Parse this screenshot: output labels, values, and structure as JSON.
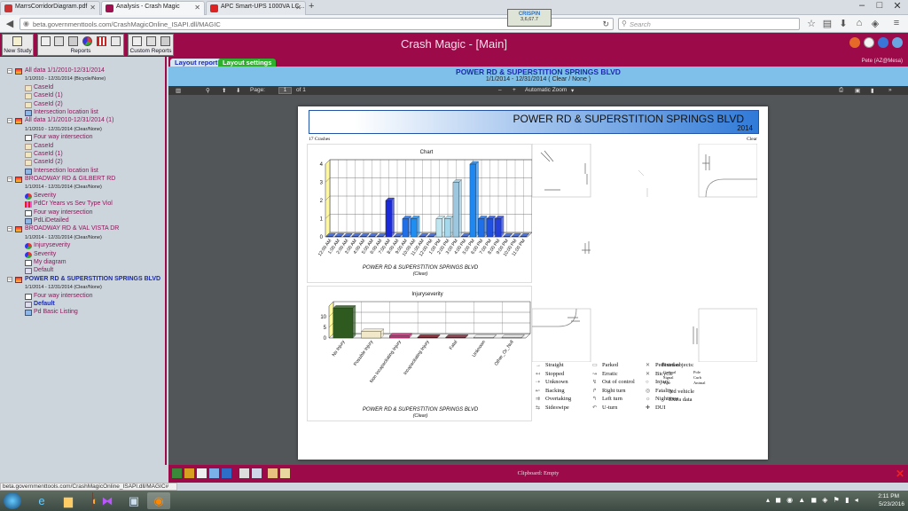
{
  "browser": {
    "tabs": [
      {
        "label": "MarrsCorridorDiagram.pdf",
        "active": false
      },
      {
        "label": "Analysis - Crash Magic",
        "active": true
      },
      {
        "label": "APC Smart-UPS 1000VA LC...",
        "active": false
      }
    ],
    "url": "beta.governmenttools.com/CrashMagicOnline_ISAPI.dll/MAGIC",
    "search_placeholder": "Search",
    "crispin_title": "CRISPIN",
    "crispin_value": "3,6,67.7"
  },
  "app": {
    "title": "Crash Magic - [Main]",
    "new_study_label": "New Study",
    "reports_label": "Reports",
    "custom_reports_label": "Custom Reports",
    "user_label": "Pete (AZ@Mesa)"
  },
  "tree": [
    {
      "kind": "top",
      "text": "All data 1/1/2010-12/31/2014"
    },
    {
      "kind": "sub",
      "text": "1/1/2010 - 12/31/2014 (Bicycle/None)"
    },
    {
      "kind": "leaf",
      "text": "CaseId",
      "icon": "person"
    },
    {
      "kind": "leaf",
      "text": "CaseId (1)",
      "icon": "person"
    },
    {
      "kind": "leaf",
      "text": "CaseId (2)",
      "icon": "person"
    },
    {
      "kind": "leaf",
      "text": "Intersection location list",
      "icon": "list"
    },
    {
      "kind": "top",
      "text": "All data 1/1/2010-12/31/2014 (1)"
    },
    {
      "kind": "sub",
      "text": "1/1/2010 - 12/31/2014 (Clear/None)"
    },
    {
      "kind": "leaf",
      "text": "Four way intersection",
      "icon": "diagram"
    },
    {
      "kind": "leaf",
      "text": "CaseId",
      "icon": "person"
    },
    {
      "kind": "leaf",
      "text": "CaseId (1)",
      "icon": "person"
    },
    {
      "kind": "leaf",
      "text": "CaseId (2)",
      "icon": "person"
    },
    {
      "kind": "leaf",
      "text": "Intersection location list",
      "icon": "list"
    },
    {
      "kind": "top",
      "text": "BROADWAY RD & GILBERT RD"
    },
    {
      "kind": "sub",
      "text": "1/1/2014 - 12/31/2014 (Clear/None)"
    },
    {
      "kind": "leaf",
      "text": "Severity",
      "icon": "pie"
    },
    {
      "kind": "leaf",
      "text": "PdCr Years vs Sev Type Viol",
      "icon": "grid"
    },
    {
      "kind": "leaf",
      "text": "Four way intersection",
      "icon": "diagram"
    },
    {
      "kind": "leaf",
      "text": "PdLiDetailed",
      "icon": "list"
    },
    {
      "kind": "top",
      "text": "BROADWAY RD & VAL VISTA DR"
    },
    {
      "kind": "sub",
      "text": "1/1/2014 - 12/31/2014 (Clear/None)"
    },
    {
      "kind": "leaf",
      "text": "Injuryseverity",
      "icon": "pie"
    },
    {
      "kind": "leaf",
      "text": "Severity",
      "icon": "pie"
    },
    {
      "kind": "leaf",
      "text": "My diagram",
      "icon": "diagram"
    },
    {
      "kind": "leaf",
      "text": "Default",
      "icon": "doc"
    },
    {
      "kind": "top-selected",
      "text": "POWER RD & SUPERSTITION SPRINGS BLVD"
    },
    {
      "kind": "sub",
      "text": "1/1/2014 - 12/31/2014 (Clear/None)"
    },
    {
      "kind": "leaf",
      "text": "Four way intersection",
      "icon": "diagram"
    },
    {
      "kind": "leaf-selected",
      "text": "Default",
      "icon": "doc"
    },
    {
      "kind": "leaf",
      "text": "Pd Basic Listing",
      "icon": "list"
    }
  ],
  "report": {
    "tabs": [
      {
        "label": "Layout report",
        "active": true
      },
      {
        "label": "Layout settings",
        "active": false
      }
    ],
    "title": "POWER RD & SUPERSTITION SPRINGS BLVD",
    "subtitle": "1/1/2014 - 12/31/2014 ( Clear / None )",
    "pdf_page_label": "Page:",
    "pdf_page_value": "1",
    "pdf_of": "of 1",
    "pdf_zoom": "Automatic Zoom",
    "page_title": "POWER RD & SUPERSTITION SPRINGS BLVD",
    "page_year": "2014",
    "crash_count": "17 Crashes",
    "weather": "Clear",
    "chart1_footer": "POWER RD & SUPERSTITION SPRINGS BLVD",
    "chart1_footer2": "(Clear)",
    "chart2_footer": "POWER RD & SUPERSTITION SPRINGS BLVD",
    "chart2_footer2": "(Clear)",
    "legend": [
      {
        "sym": "→",
        "text": "Straight"
      },
      {
        "sym": "↤",
        "text": "Stopped"
      },
      {
        "sym": "⇢",
        "text": "Unknown"
      },
      {
        "sym": "↜",
        "text": "Backing"
      },
      {
        "sym": "⇉",
        "text": "Overtaking"
      },
      {
        "sym": "⇆",
        "text": "Sideswipe"
      },
      {
        "sym": "▭",
        "text": "Parked"
      },
      {
        "sym": "↝",
        "text": "Erratic"
      },
      {
        "sym": "↯",
        "text": "Out of control"
      },
      {
        "sym": "↱",
        "text": "Right turn"
      },
      {
        "sym": "↰",
        "text": "Left turn"
      },
      {
        "sym": "↶",
        "text": "U-turn"
      },
      {
        "sym": "✕",
        "text": "Pedestrian"
      },
      {
        "sym": "✕",
        "text": "Bicycle"
      },
      {
        "sym": "○",
        "text": "Injury"
      },
      {
        "sym": "◎",
        "text": "Fatality"
      },
      {
        "sym": "☼",
        "text": "Nighttime"
      },
      {
        "sym": "✚",
        "text": "DUI"
      }
    ],
    "fixed_objects_title": "Fixed objects:",
    "fixed_objects": [
      "General",
      "Pole",
      "Signal",
      "Curb",
      "Tree",
      "Animal"
    ],
    "extra_legend": [
      "3rd vehicle",
      "Extra data"
    ],
    "clipboard": "Clipboard: Empty"
  },
  "status_url": "beta.governmenttools.com/CrashMagicOnline_ISAPI.dll/MAGIC#",
  "clock": {
    "time": "2:11 PM",
    "date": "5/23/2016"
  },
  "colors": {
    "brand": "#9c0a4a",
    "panel": "#ccd4dc",
    "title_bar": "#7fc0ea",
    "link": "#8a1b5a",
    "selected": "#1a2bb5"
  },
  "chart_data": [
    {
      "type": "bar",
      "title": "Chart",
      "categories": [
        "12:00 AM",
        "1:00 AM",
        "2:00 AM",
        "3:00 AM",
        "4:00 AM",
        "5:00 AM",
        "6:00 AM",
        "7:00 AM",
        "8:00 AM",
        "9:00 AM",
        "10:00 AM",
        "11:00 AM",
        "12:00 PM",
        "1:00 PM",
        "2:00 PM",
        "3:00 PM",
        "4:00 PM",
        "5:00 PM",
        "6:00 PM",
        "7:00 PM",
        "8:00 PM",
        "9:00 PM",
        "10:00 PM",
        "11:00 PM"
      ],
      "values": [
        0,
        0,
        0,
        0,
        0,
        0,
        0,
        2,
        0,
        1,
        1,
        0,
        0,
        1,
        1,
        3,
        0,
        4,
        1,
        1,
        1,
        0,
        0,
        0
      ],
      "ylim": [
        0,
        4
      ],
      "yticks": [
        0,
        1,
        2,
        3,
        4
      ],
      "grid": true,
      "colors": [
        "#2f5fe0",
        "#2f5fe0",
        "#2f5fe0",
        "#2f5fe0",
        "#2f5fe0",
        "#2f5fe0",
        "#2f5fe0",
        "#1a2ad6",
        "#2f5fe0",
        "#1f6fe8",
        "#1f8ef0",
        "#2f5fe0",
        "#2f5fe0",
        "#bfe6f0",
        "#a6d8ec",
        "#9cc7de",
        "#2f5fe0",
        "#1e88f0",
        "#1e6fe8",
        "#2050e0",
        "#2440d8",
        "#2f5fe0",
        "#2f5fe0",
        "#2f5fe0"
      ]
    },
    {
      "type": "bar",
      "title": "Injuryseverity",
      "categories": [
        "No Injury",
        "Possible Injury",
        "Non Incapacitating Injury",
        "Incapacitating Injury",
        "Fatal",
        "Unknown",
        "Other_Or_Null"
      ],
      "values": [
        14,
        3,
        1,
        0,
        0,
        0,
        0
      ],
      "ylim": [
        0,
        15
      ],
      "yticks": [
        0,
        5,
        10
      ],
      "grid": true,
      "colors": [
        "#2e5a1f",
        "#f0e8c8",
        "#c0357a",
        "#7a1220",
        "#7a2a3a",
        "#eeeeee",
        "#e0e0e0"
      ]
    }
  ]
}
